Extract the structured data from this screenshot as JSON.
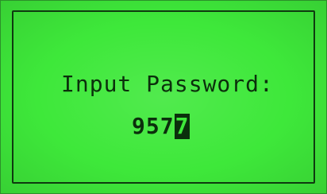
{
  "screen": {
    "prompt": "Input Password:",
    "entered_digits": "957",
    "cursor_digit": "7"
  },
  "colors": {
    "lcd_background": "#3ee83a",
    "pixel_dark": "#0b2f0c",
    "frame": "#0f3a10"
  }
}
